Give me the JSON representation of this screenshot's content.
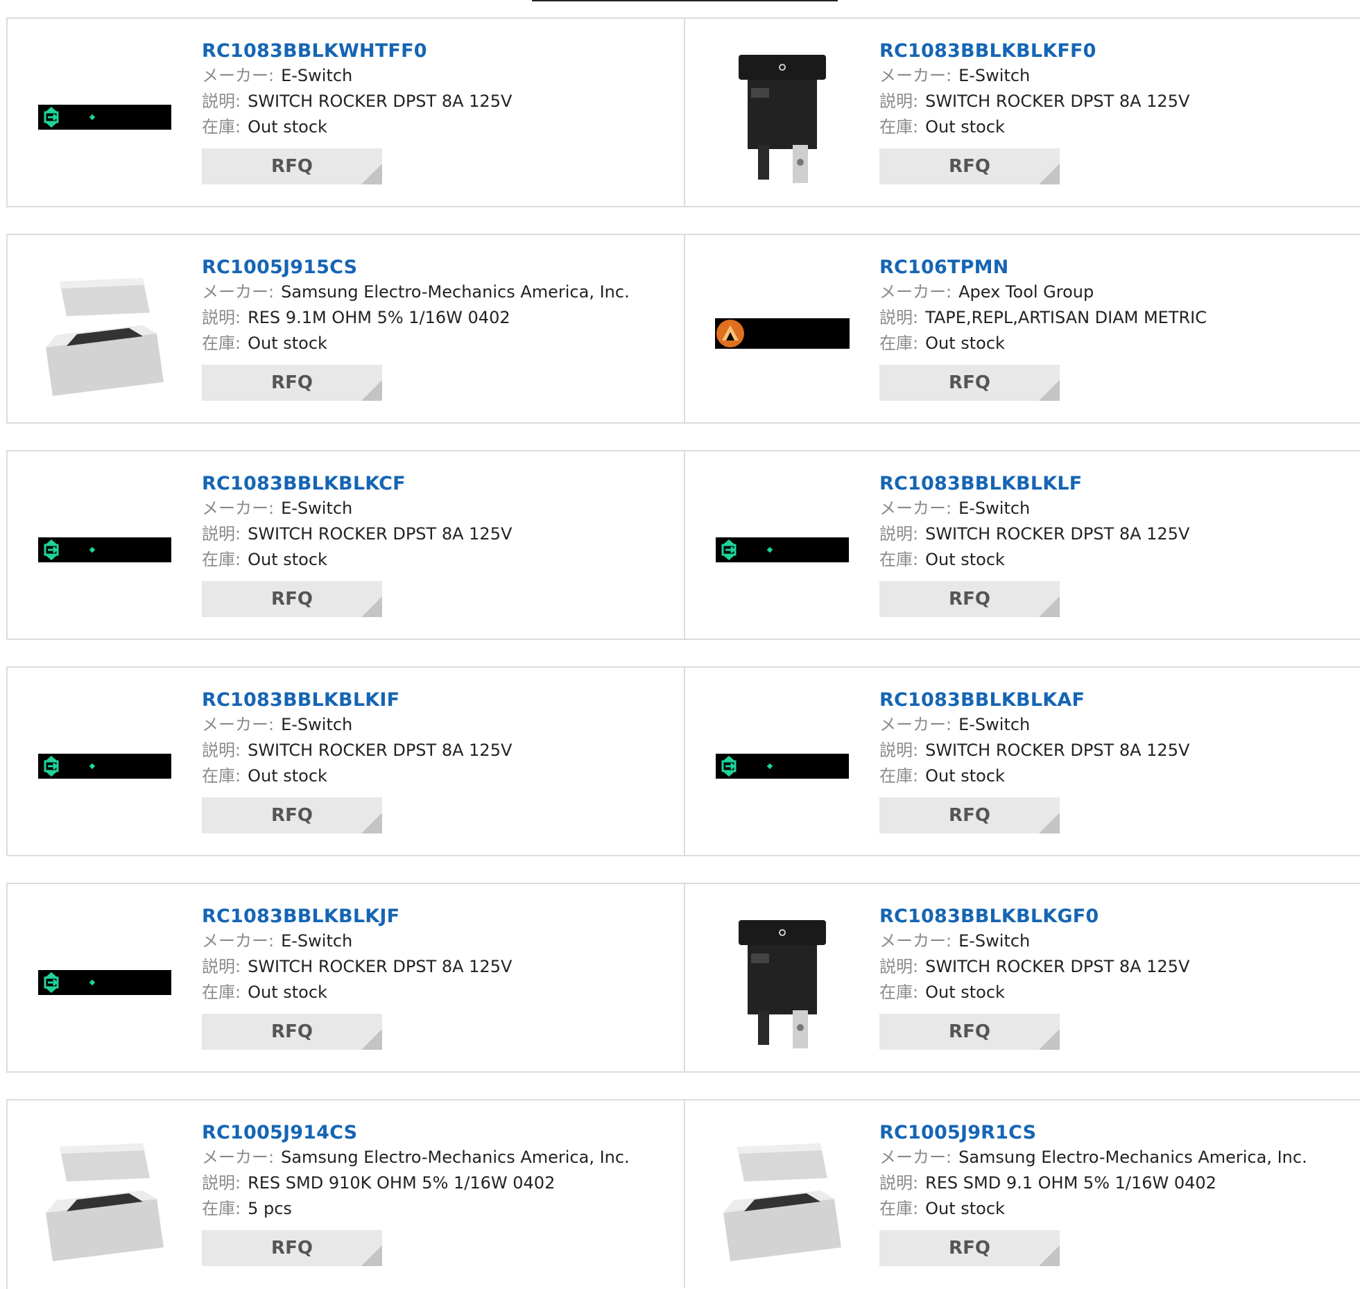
{
  "labels": {
    "maker": "メーカー:",
    "desc": "説明:",
    "stock": "在庫:",
    "rfq": "RFQ"
  },
  "products": [
    {
      "part": "RC1083BBLKWHTFF0",
      "maker": "E-Switch",
      "desc": "SWITCH ROCKER DPST 8A 125V",
      "stock": "Out stock",
      "image": "led-strip-image"
    },
    {
      "part": "RC1083BBLKBLKFF0",
      "maker": "E-Switch",
      "desc": "SWITCH ROCKER DPST 8A 125V",
      "stock": "Out stock",
      "image": "rocker-switch-image"
    },
    {
      "part": "RC1005J915CS",
      "maker": "Samsung Electro-Mechanics America, Inc.",
      "desc": "RES 9.1M OHM 5% 1/16W 0402",
      "stock": "Out stock",
      "image": "chip-resistor-image"
    },
    {
      "part": "RC106TPMN",
      "maker": "Apex Tool Group",
      "desc": "TAPE,REPL,ARTISAN DIAM METRIC",
      "stock": "Out stock",
      "image": "orange-logo-strip-image"
    },
    {
      "part": "RC1083BBLKBLKCF",
      "maker": "E-Switch",
      "desc": "SWITCH ROCKER DPST 8A 125V",
      "stock": "Out stock",
      "image": "led-strip-image"
    },
    {
      "part": "RC1083BBLKBLKLF",
      "maker": "E-Switch",
      "desc": "SWITCH ROCKER DPST 8A 125V",
      "stock": "Out stock",
      "image": "led-strip-image"
    },
    {
      "part": "RC1083BBLKBLKIF",
      "maker": "E-Switch",
      "desc": "SWITCH ROCKER DPST 8A 125V",
      "stock": "Out stock",
      "image": "led-strip-image"
    },
    {
      "part": "RC1083BBLKBLKAF",
      "maker": "E-Switch",
      "desc": "SWITCH ROCKER DPST 8A 125V",
      "stock": "Out stock",
      "image": "led-strip-image"
    },
    {
      "part": "RC1083BBLKBLKJF",
      "maker": "E-Switch",
      "desc": "SWITCH ROCKER DPST 8A 125V",
      "stock": "Out stock",
      "image": "led-strip-image"
    },
    {
      "part": "RC1083BBLKBLKGF0",
      "maker": "E-Switch",
      "desc": "SWITCH ROCKER DPST 8A 125V",
      "stock": "Out stock",
      "image": "rocker-switch-image"
    },
    {
      "part": "RC1005J914CS",
      "maker": "Samsung Electro-Mechanics America, Inc.",
      "desc": "RES SMD 910K OHM 5% 1/16W 0402",
      "stock": "5 pcs",
      "image": "chip-resistor-image"
    },
    {
      "part": "RC1005J9R1CS",
      "maker": "Samsung Electro-Mechanics America, Inc.",
      "desc": "RES SMD 9.1 OHM 5% 1/16W 0402",
      "stock": "Out stock",
      "image": "chip-resistor-image"
    }
  ]
}
